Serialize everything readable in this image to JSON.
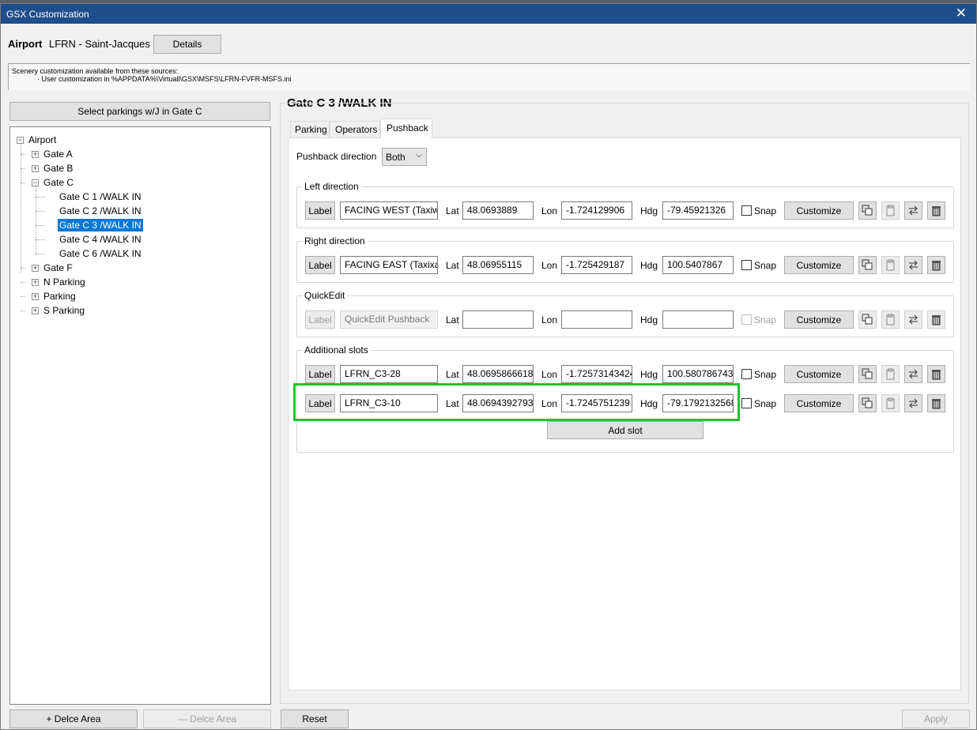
{
  "window": {
    "title": "GSX Customization",
    "close_glyph": "✕"
  },
  "header": {
    "airport_label": "Airport",
    "airport_value": "LFRN - Saint-Jacques",
    "details_button": "Details"
  },
  "sources": {
    "line1": "Scenery customization available from these sources:",
    "line2": "· User customization in %APPDATA%\\Virtuall\\GSX\\MSFS\\LFRN-FVFR-MSFS.ini"
  },
  "left_panel": {
    "select_button": "Select parkings w/J in Gate C",
    "tree": [
      {
        "label": "Airport",
        "level": 0,
        "expander": "−"
      },
      {
        "label": "Gate A",
        "level": 1,
        "expander": "+"
      },
      {
        "label": "Gate B",
        "level": 1,
        "expander": "+"
      },
      {
        "label": "Gate C",
        "level": 1,
        "expander": "−"
      },
      {
        "label": "Gate C 1 /WALK IN",
        "level": 2,
        "expander": ""
      },
      {
        "label": "Gate C 2 /WALK IN",
        "level": 2,
        "expander": ""
      },
      {
        "label": "Gate C 3 /WALK IN",
        "level": 2,
        "expander": "",
        "selected": true
      },
      {
        "label": "Gate C 4 /WALK IN",
        "level": 2,
        "expander": ""
      },
      {
        "label": "Gate C 6 /WALK IN",
        "level": 2,
        "expander": ""
      },
      {
        "label": "Gate F",
        "level": 1,
        "expander": "+"
      },
      {
        "label": "N Parking",
        "level": 1,
        "expander": "+"
      },
      {
        "label": "Parking",
        "level": 1,
        "expander": "+"
      },
      {
        "label": "S Parking",
        "level": 1,
        "expander": "+"
      }
    ],
    "add_area_button": "+ Delce Area",
    "remove_area_button": "— Delce Area"
  },
  "main": {
    "title": "Gate C 3 /WALK IN",
    "tabs": [
      "Parking",
      "Operators",
      "Pushback"
    ],
    "active_tab": "Pushback",
    "pushback_direction_label": "Pushback direction",
    "pushback_direction_value": "Both",
    "field_labels": {
      "lat": "Lat",
      "lon": "Lon",
      "hdg": "Hdg",
      "snap": "Snap",
      "label_button": "Label",
      "customize_button": "Customize"
    },
    "groups": {
      "left": {
        "title": "Left direction",
        "rows": [
          {
            "name": "FACING WEST (Taxiwa",
            "lat": "48.0693889",
            "lon": "-1.724129906",
            "hdg": "-79.45921326"
          }
        ]
      },
      "right": {
        "title": "Right direction",
        "rows": [
          {
            "name": "FACING EAST (Taxixay",
            "lat": "48.06955115",
            "lon": "-1.725429187",
            "hdg": "100.5407867"
          }
        ]
      },
      "quickedit": {
        "title": "QuickEdit",
        "rows": [
          {
            "name": "QuickEdit Pushback",
            "lat": "",
            "lon": "",
            "hdg": ""
          }
        ]
      },
      "additional": {
        "title": "Additional slots",
        "rows": [
          {
            "name": "LFRN_C3-28",
            "lat": "48.0695866618",
            "lon": "-1.72573143424",
            "hdg": "100.580786743"
          },
          {
            "name": "LFRN_C3-10",
            "lat": "48.0694392793",
            "lon": "-1.7245751239",
            "hdg": "-79.1792132568"
          }
        ],
        "add_slot_button": "Add slot"
      }
    },
    "highlight_color": "#22c32a"
  },
  "footer": {
    "reset_button": "Reset",
    "apply_button": "Apply"
  }
}
